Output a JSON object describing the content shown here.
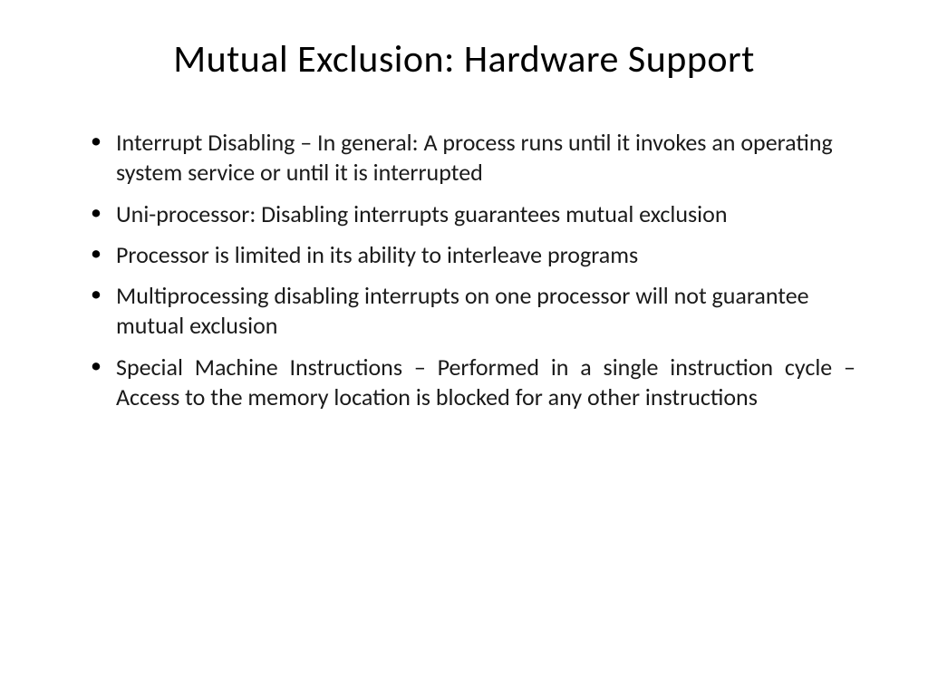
{
  "slide": {
    "title": "Mutual Exclusion: Hardware Support",
    "bullets": [
      "Interrupt Disabling – In general: A process runs until it invokes an operating system service or until it is interrupted",
      "Uni-processor: Disabling interrupts guarantees mutual exclusion",
      " Processor is limited in its ability to interleave programs",
      "Multiprocessing disabling interrupts on one processor will not guarantee mutual exclusion",
      "Special Machine Instructions – Performed in a single instruction cycle – Access to the memory location is blocked for any other instructions"
    ]
  }
}
